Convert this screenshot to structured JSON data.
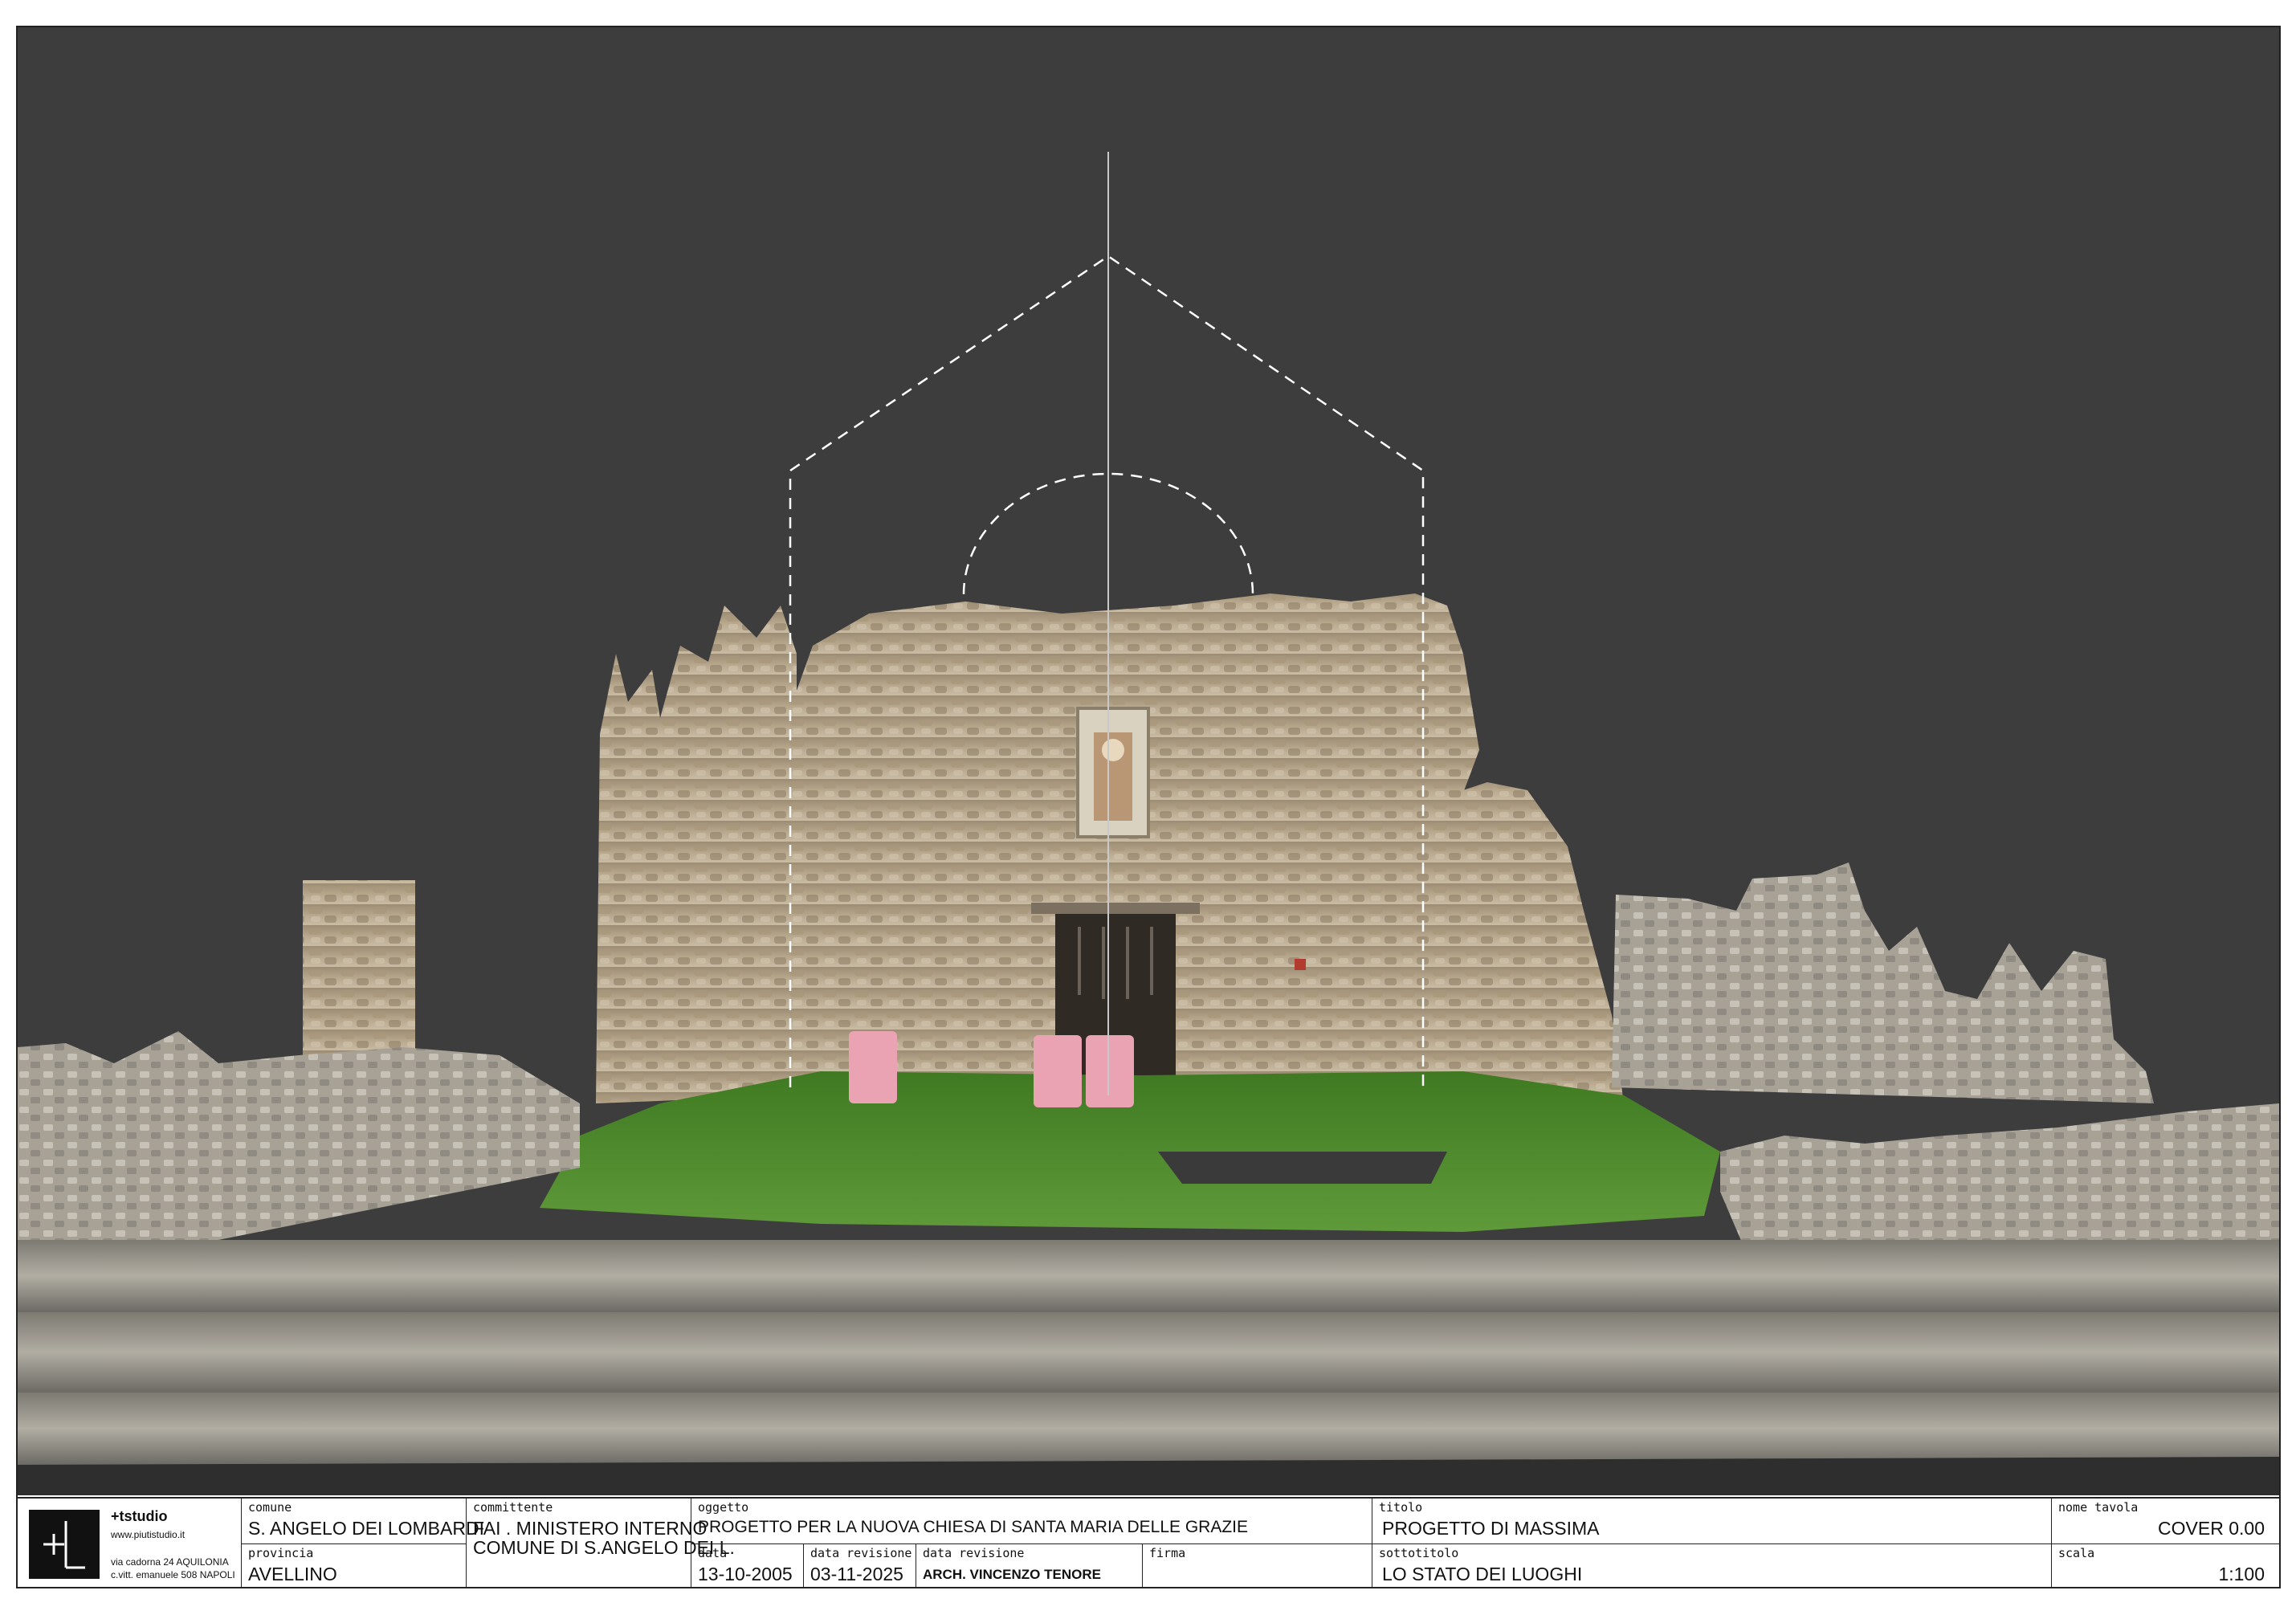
{
  "studio": {
    "name": "+tstudio",
    "website": "www.piutistudio.it",
    "address_line1": "via cadorna 24 AQUILONIA",
    "address_line2": "c.vitt. emanuele 508  NAPOLI",
    "logo_icon": "plus-t-logo"
  },
  "titleblock": {
    "comune_label": "comune",
    "comune": "S. ANGELO DEI LOMBARDI",
    "provincia_label": "provincia",
    "provincia": "AVELLINO",
    "committente_label": "committente",
    "committente_line1": "FAI . MINISTERO INTERNO",
    "committente_line2": "COMUNE DI S.ANGELO DEI L.",
    "oggetto_label": "oggetto",
    "oggetto": "PROGETTO PER LA NUOVA CHIESA DI SANTA MARIA DELLE GRAZIE",
    "data_label": "data",
    "data": "13-10-2005",
    "data_revisione_label": "data revisione",
    "data_revisione": "03-11-2025",
    "data_revisione2_label": "data revisione",
    "progettista": "ARCH. VINCENZO TENORE",
    "firma_label": "firma",
    "firma": "",
    "titolo_label": "titolo",
    "titolo": "PROGETTO DI MASSIMA",
    "sottotitolo_label": "sottotitolo",
    "sottotitolo": "LO STATO DEI LUOGHI",
    "nome_tavola_label": "nome tavola",
    "nome_tavola": "COVER 0.00",
    "scala_label": "scala",
    "scala": "1:100"
  },
  "colors": {
    "background": "#3d3d3d",
    "stone": "#b8a88e",
    "grass": "#4e8a2e",
    "pink_blocks": "#e9a3b3",
    "outline_dashed": "#ffffff"
  }
}
